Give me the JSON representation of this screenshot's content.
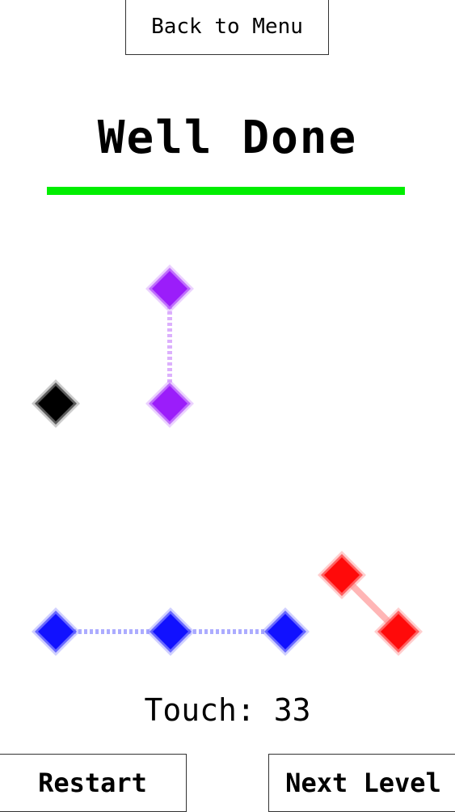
{
  "buttons": {
    "back": "Back to Menu",
    "restart": "Restart",
    "next": "Next Level"
  },
  "header": {
    "title": "Well Done",
    "bar_color": "#00ee00"
  },
  "status": {
    "touch_text": "Touch: 33"
  },
  "colors": {
    "purple": "#9b1dfa",
    "black": "#000000",
    "blue": "#1111ff",
    "red": "#ff0a0a"
  }
}
